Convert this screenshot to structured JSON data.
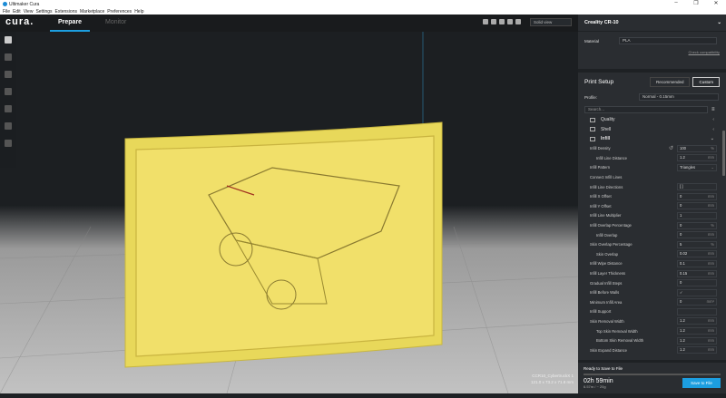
{
  "window": {
    "title": "Ultimaker Cura",
    "controls": [
      "–",
      "❐",
      "✕"
    ]
  },
  "menu": [
    "File",
    "Edit",
    "View",
    "Settings",
    "Extensions",
    "Marketplace",
    "Preferences",
    "Help"
  ],
  "header": {
    "brand": "cura.",
    "tabs": [
      "Prepare",
      "Monitor"
    ],
    "view_select": "Solid view"
  },
  "object": {
    "name": "CCR10_CybertruckX 1",
    "dims": "121.0 x 73.2 x 71.8 mm"
  },
  "printer": {
    "name": "Creality CR-10",
    "material_label": "Material",
    "material": "PLA",
    "check": "Check compatibility"
  },
  "print_setup": {
    "title": "Print Setup",
    "modes": [
      "Recommended",
      "Custom"
    ],
    "profile_label": "Profile:",
    "profile": "Normal - 0.15mm",
    "search_placeholder": "Search..."
  },
  "categories": [
    {
      "label": "Quality",
      "chev": "‹"
    },
    {
      "label": "Shell",
      "chev": "‹"
    },
    {
      "label": "Infill",
      "chev": "⌄"
    }
  ],
  "settings": [
    {
      "label": "Infill Density",
      "value": "100",
      "unit": "%"
    },
    {
      "label": "Infill Line Distance",
      "value": "1.2",
      "unit": "mm",
      "sub": true
    },
    {
      "label": "Infill Pattern",
      "value": "Triangles",
      "unit": "⌄"
    },
    {
      "label": "Connect Infill Lines",
      "value": "",
      "unit": "",
      "novalue": true
    },
    {
      "label": "Infill Line Directions",
      "value": "[ ]",
      "unit": ""
    },
    {
      "label": "Infill X Offset",
      "value": "0",
      "unit": "mm"
    },
    {
      "label": "Infill Y Offset",
      "value": "0",
      "unit": "mm"
    },
    {
      "label": "Infill Line Multiplier",
      "value": "1",
      "unit": ""
    },
    {
      "label": "Infill Overlap Percentage",
      "value": "0",
      "unit": "%"
    },
    {
      "label": "Infill Overlap",
      "value": "0",
      "unit": "mm",
      "sub": true
    },
    {
      "label": "Skin Overlap Percentage",
      "value": "5",
      "unit": "%"
    },
    {
      "label": "Skin Overlap",
      "value": "0.02",
      "unit": "mm",
      "sub": true
    },
    {
      "label": "Infill Wipe Distance",
      "value": "0.1",
      "unit": "mm"
    },
    {
      "label": "Infill Layer Thickness",
      "value": "0.15",
      "unit": "mm"
    },
    {
      "label": "Gradual Infill Steps",
      "value": "0",
      "unit": ""
    },
    {
      "label": "Infill Before Walls",
      "value": "✓",
      "unit": ""
    },
    {
      "label": "Minimum Infill Area",
      "value": "0",
      "unit": "mm²"
    },
    {
      "label": "Infill Support",
      "value": "",
      "unit": ""
    },
    {
      "label": "Skin Removal Width",
      "value": "1.2",
      "unit": "mm"
    },
    {
      "label": "Top Skin Removal Width",
      "value": "1.2",
      "unit": "mm",
      "sub": true
    },
    {
      "label": "Bottom Skin Removal Width",
      "value": "1.2",
      "unit": "mm",
      "sub": true
    },
    {
      "label": "Skin Expand Distance",
      "value": "1.2",
      "unit": "mm"
    }
  ],
  "footer": {
    "status": "Ready to Save to File",
    "time": "02h 59min",
    "material_use": "6.57m / ~ 20g",
    "save": "Save to File"
  }
}
